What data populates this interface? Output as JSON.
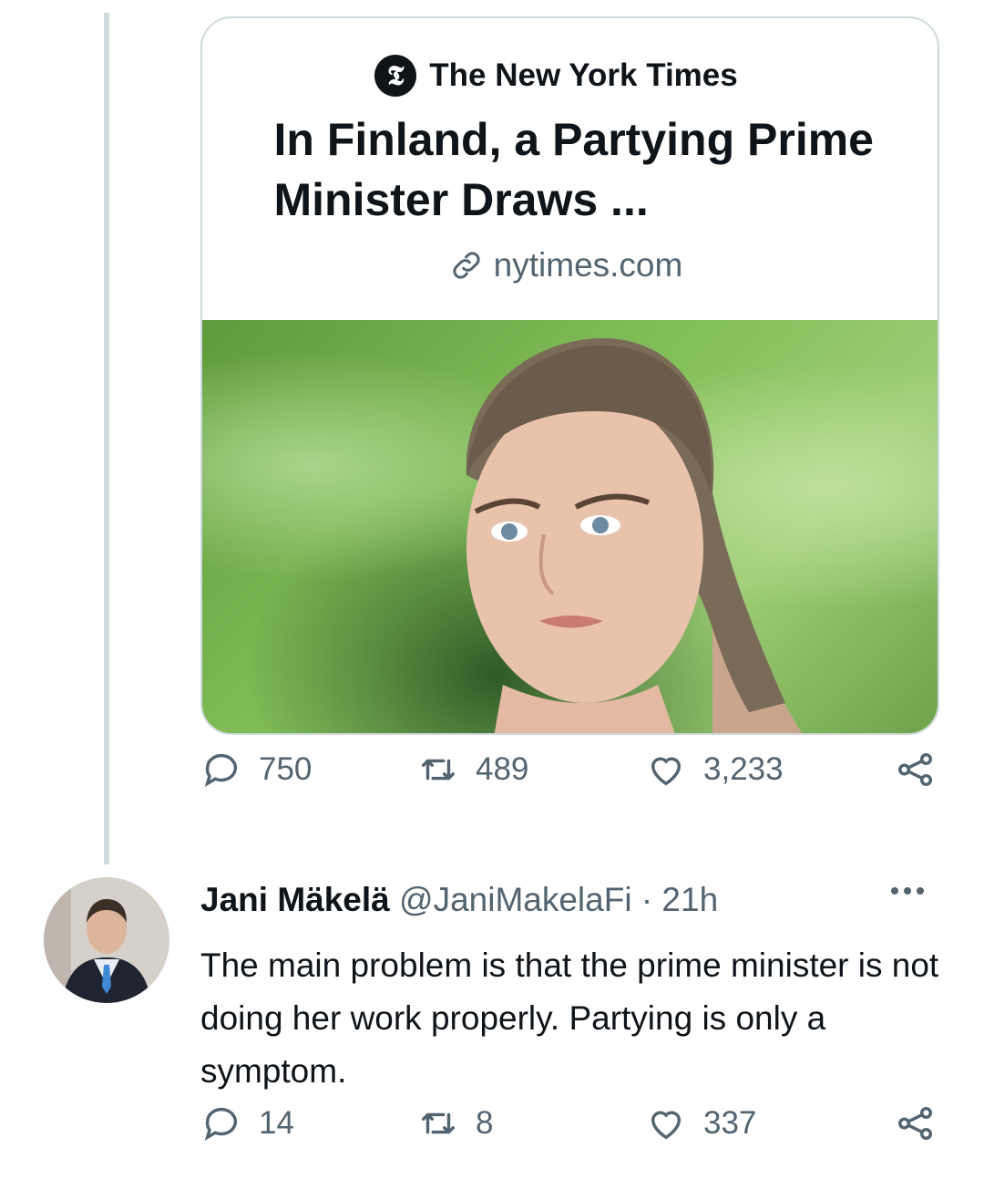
{
  "quoted_tweet": {
    "card": {
      "source_name": "The New York Times",
      "source_logo_glyph": "𝕿",
      "headline": "In Finland, a Partying Prime Minister Draws ...",
      "domain": "nytimes.com",
      "image_icon": "news-photo-portrait"
    },
    "stats": {
      "replies": "750",
      "retweets": "489",
      "likes": "3,233"
    }
  },
  "reply_tweet": {
    "author_name": "Jani Mäkelä",
    "handle_and_time": "@JaniMakelaFi · 21h",
    "text": "The main problem is that the prime minister is not doing her work properly. Partying is only a symptom.",
    "stats": {
      "replies": "14",
      "retweets": "8",
      "likes": "337"
    }
  },
  "colors": {
    "text_primary": "#0f1419",
    "text_secondary": "#536471",
    "border": "#cfd9de"
  }
}
